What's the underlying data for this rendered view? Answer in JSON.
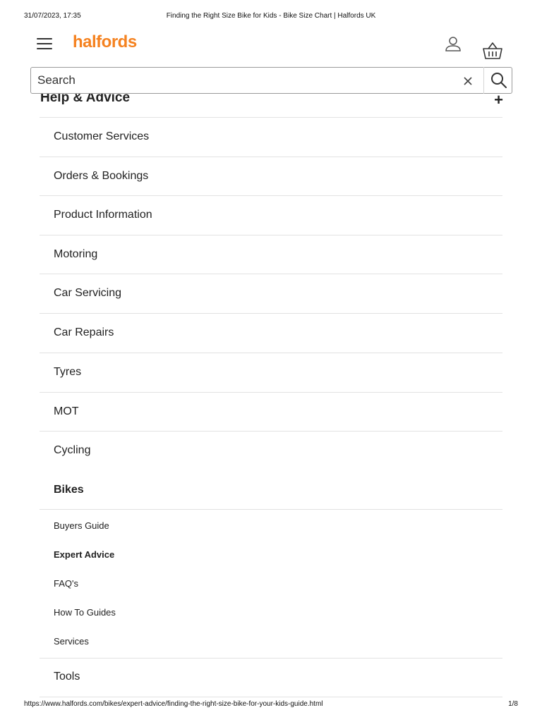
{
  "print_header": {
    "datetime": "31/07/2023, 17:35",
    "page_title": "Finding the Right Size Bike for Kids - Bike Size Chart | Halfords UK"
  },
  "print_footer": {
    "url": "https://www.halfords.com/bikes/expert-advice/finding-the-right-size-bike-for-your-kids-guide.html",
    "page_number": "1/8"
  },
  "brand": {
    "logo_text": "halfords",
    "accent_color": "#f58220"
  },
  "icons": {
    "menu": "hamburger-icon",
    "account": "user-icon",
    "basket": "basket-icon",
    "clear": "close-icon",
    "search": "search-icon",
    "expand": "plus-icon"
  },
  "search": {
    "placeholder": "Search"
  },
  "section": {
    "title": "Help & Advice",
    "expand_symbol": "+"
  },
  "menu": {
    "items": [
      {
        "label": "Customer Services"
      },
      {
        "label": "Orders & Bookings"
      },
      {
        "label": "Product Information"
      },
      {
        "label": "Motoring"
      },
      {
        "label": "Car Servicing"
      },
      {
        "label": "Car Repairs"
      },
      {
        "label": "Tyres"
      },
      {
        "label": "MOT"
      },
      {
        "label": "Cycling"
      },
      {
        "label": "Bikes",
        "active": true
      },
      {
        "label": "Buyers Guide"
      },
      {
        "label": "Expert Advice",
        "active": true
      },
      {
        "label": "FAQ's"
      },
      {
        "label": "How To Guides"
      },
      {
        "label": "Services"
      },
      {
        "label": "Tools"
      }
    ]
  }
}
